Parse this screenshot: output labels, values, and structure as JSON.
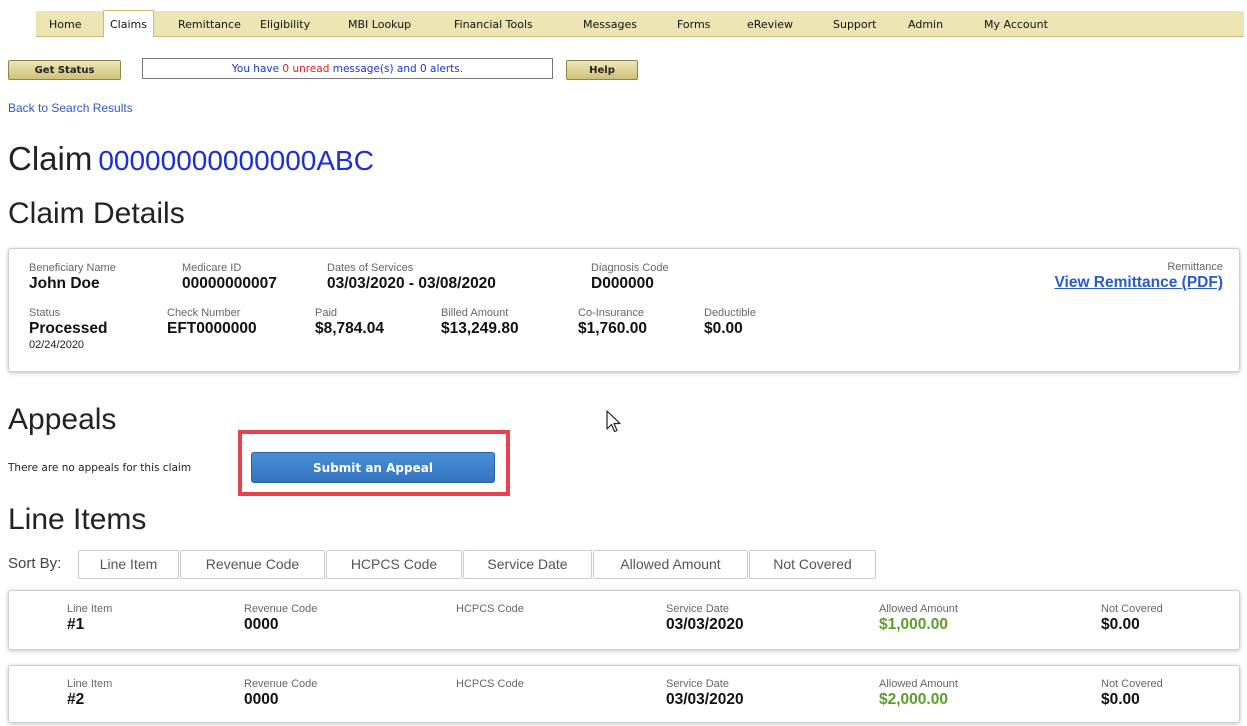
{
  "nav": {
    "items": [
      {
        "label": "Home"
      },
      {
        "label": "Claims",
        "active": true
      },
      {
        "label": "Remittance"
      },
      {
        "label": "Eligibility"
      },
      {
        "label": "MBI Lookup"
      },
      {
        "label": "Financial Tools"
      },
      {
        "label": "Messages"
      },
      {
        "label": "Forms"
      },
      {
        "label": "eReview"
      },
      {
        "label": "Support"
      },
      {
        "label": "Admin"
      },
      {
        "label": "My Account"
      }
    ]
  },
  "toolbar": {
    "get_status_label": "Get Status",
    "help_label": "Help",
    "message_prefix": "You have ",
    "unread_text": "0 unread",
    "message_suffix": " message(s) and 0 alerts."
  },
  "back_link": "Back to Search Results",
  "claim": {
    "title_prefix": "Claim",
    "number": "00000000000000ABC"
  },
  "claim_details": {
    "heading": "Claim Details",
    "beneficiary_label": "Beneficiary Name",
    "beneficiary_value": "John Doe",
    "medicare_id_label": "Medicare ID",
    "medicare_id_value": "00000000007",
    "dates_label": "Dates of Services",
    "dates_value": "03/03/2020 - 03/08/2020",
    "diagnosis_label": "Diagnosis Code",
    "diagnosis_value": "D000000",
    "remittance_label": "Remittance",
    "remittance_link": "View Remittance (PDF)",
    "status_label": "Status",
    "status_value": "Processed",
    "status_date": "02/24/2020",
    "check_label": "Check Number",
    "check_value": "EFT0000000",
    "paid_label": "Paid",
    "paid_value": "$8,784.04",
    "billed_label": "Billed Amount",
    "billed_value": "$13,249.80",
    "coins_label": "Co-Insurance",
    "coins_value": "$1,760.00",
    "deductible_label": "Deductible",
    "deductible_value": "$0.00"
  },
  "appeals": {
    "heading": "Appeals",
    "empty_text": "There are no appeals for this claim",
    "submit_label": "Submit an Appeal"
  },
  "line_items": {
    "heading": "Line Items",
    "sort_label": "Sort By:",
    "sort_options": [
      "Line Item",
      "Revenue Code",
      "HCPCS Code",
      "Service Date",
      "Allowed Amount",
      "Not Covered"
    ],
    "col_labels": {
      "line": "Line Item",
      "revenue": "Revenue Code",
      "hcpcs": "HCPCS Code",
      "service_date": "Service Date",
      "allowed": "Allowed Amount",
      "not_covered": "Not Covered"
    },
    "rows": [
      {
        "line": "#1",
        "revenue": "0000",
        "hcpcs": "",
        "service_date": "03/03/2020",
        "allowed": "$1,000.00",
        "not_covered": "$0.00"
      },
      {
        "line": "#2",
        "revenue": "0000",
        "hcpcs": "",
        "service_date": "03/03/2020",
        "allowed": "$2,000.00",
        "not_covered": "$0.00"
      }
    ]
  },
  "colors": {
    "nav_bg": "#ece4b2",
    "link": "#2a5cc4",
    "claim_number": "#1a2fd8",
    "allowed_green": "#5a9e28",
    "appeal_button": "#3a7fca",
    "highlight_red": "#e8434d"
  }
}
